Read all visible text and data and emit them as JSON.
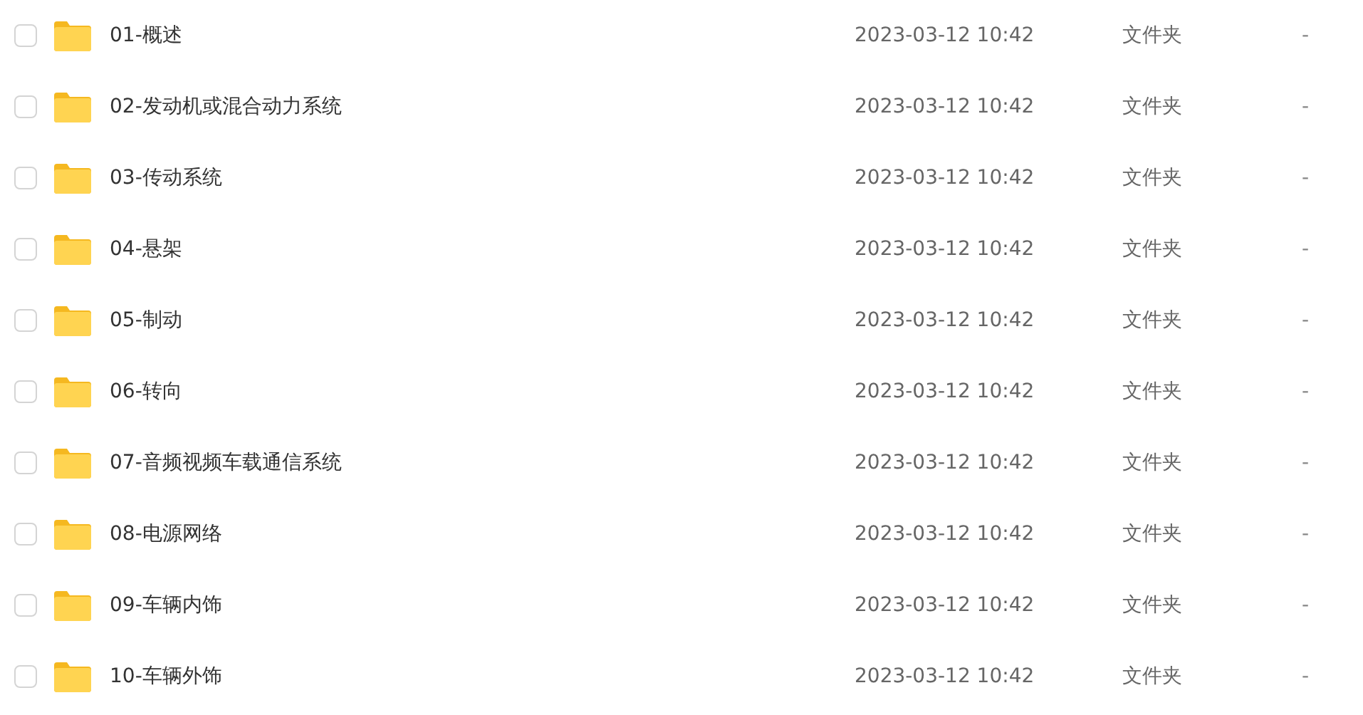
{
  "rows": [
    {
      "name": "01-概述",
      "modified": "2023-03-12 10:42",
      "type": "文件夹",
      "size": "-",
      "checked": false
    },
    {
      "name": "02-发动机或混合动力系统",
      "modified": "2023-03-12 10:42",
      "type": "文件夹",
      "size": "-",
      "checked": false
    },
    {
      "name": "03-传动系统",
      "modified": "2023-03-12 10:42",
      "type": "文件夹",
      "size": "-",
      "checked": false
    },
    {
      "name": "04-悬架",
      "modified": "2023-03-12 10:42",
      "type": "文件夹",
      "size": "-",
      "checked": false
    },
    {
      "name": "05-制动",
      "modified": "2023-03-12 10:42",
      "type": "文件夹",
      "size": "-",
      "checked": false
    },
    {
      "name": "06-转向",
      "modified": "2023-03-12 10:42",
      "type": "文件夹",
      "size": "-",
      "checked": false
    },
    {
      "name": "07-音频视频车载通信系统",
      "modified": "2023-03-12 10:42",
      "type": "文件夹",
      "size": "-",
      "checked": false
    },
    {
      "name": "08-电源网络",
      "modified": "2023-03-12 10:42",
      "type": "文件夹",
      "size": "-",
      "checked": false
    },
    {
      "name": "09-车辆内饰",
      "modified": "2023-03-12 10:42",
      "type": "文件夹",
      "size": "-",
      "checked": false
    },
    {
      "name": "10-车辆外饰",
      "modified": "2023-03-12 10:42",
      "type": "文件夹",
      "size": "-",
      "checked": false
    }
  ]
}
